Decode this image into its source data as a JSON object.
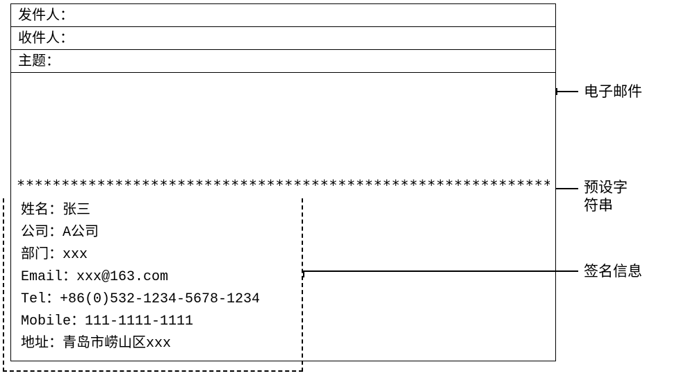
{
  "email": {
    "from_label": "发件人：",
    "to_label": "收件人：",
    "subject_label": "主题：",
    "preset_string": "*************************************************************"
  },
  "signature": {
    "name_label": "姓名：",
    "name": "张三",
    "company_label": "公司：",
    "company": "A公司",
    "dept_label": "部门：",
    "dept": "xxx",
    "email_label": "Email：",
    "email": "xxx@163.com",
    "tel_label": "Tel：",
    "tel": "+86(0)532-1234-5678-1234",
    "mobile_label": "Mobile：",
    "mobile": "111-1111-1111",
    "address_label": "地址：",
    "address": "青岛市崂山区xxx"
  },
  "annotations": {
    "email": "电子邮件",
    "preset_line1": "预设字",
    "preset_line2": "符串",
    "signature": "签名信息"
  }
}
